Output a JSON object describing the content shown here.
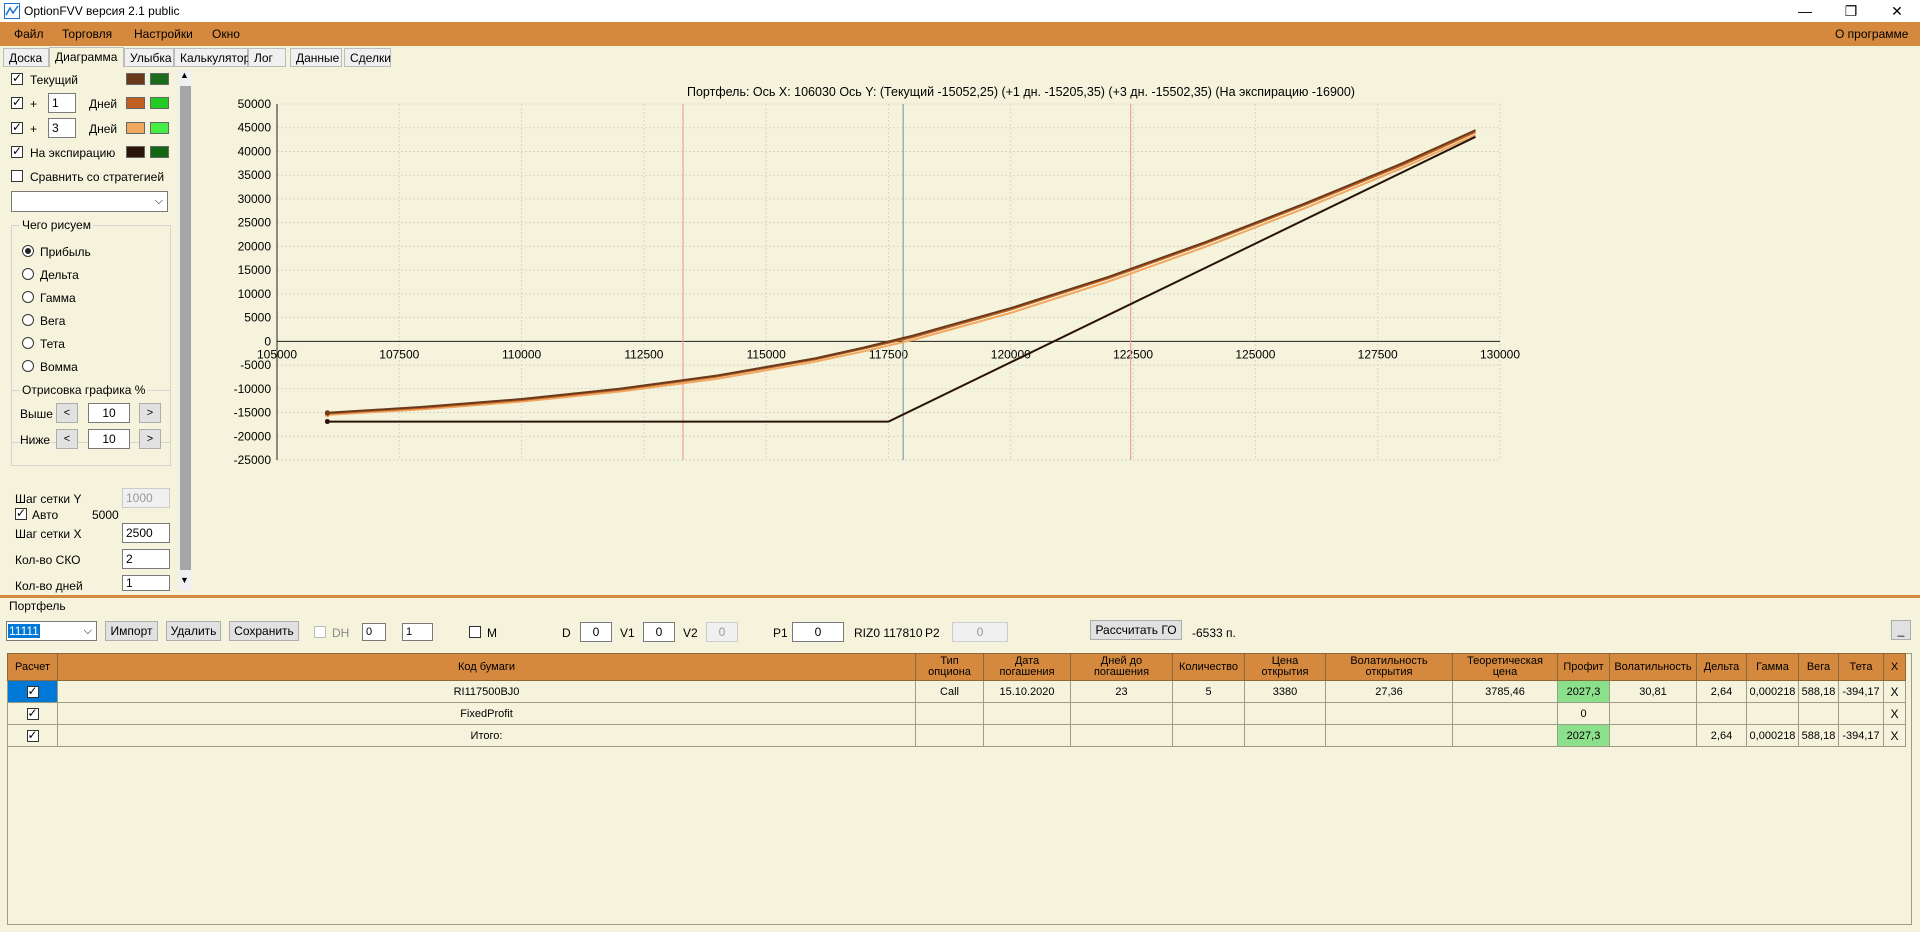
{
  "window": {
    "title": "OptionFVV версия 2.1 public",
    "controls": [
      "—",
      "❐",
      "✕"
    ]
  },
  "menu": {
    "items": [
      "Файл",
      "Торговля",
      "Настройки",
      "Окно"
    ],
    "about": "О программе"
  },
  "tabs": [
    "Доска",
    "Диаграмма",
    "Улыбка",
    "Калькулятор",
    "Лог",
    "Данные",
    "Сделки"
  ],
  "left": {
    "curves": [
      {
        "label": "Текущий",
        "checked": true,
        "colors": [
          "#6b3a1c",
          "#1a6b1a"
        ]
      },
      {
        "prefix": "+",
        "days": "1",
        "label": "Дней",
        "checked": true,
        "colors": [
          "#c06020",
          "#22cc22"
        ]
      },
      {
        "prefix": "+",
        "days": "3",
        "label": "Дней",
        "checked": true,
        "colors": [
          "#f0a860",
          "#44ee44"
        ]
      },
      {
        "label": "На экспирацию",
        "checked": true,
        "colors": [
          "#2a1408",
          "#116611"
        ]
      }
    ],
    "compare_label": "Сравнить со стратегией",
    "what_title": "Чего рисуем",
    "radios": [
      "Прибыль",
      "Дельта",
      "Гамма",
      "Вега",
      "Тета",
      "Вомма"
    ],
    "radio_selected": 0,
    "draw_title": "Отрисовка графика %",
    "above_label": "Выше",
    "above_value": "10",
    "below_label": "Ниже",
    "below_value": "10",
    "left_arrow": "<",
    "right_arrow": ">",
    "grid_y_label": "Шаг сетки Y",
    "grid_y_value": "1000",
    "auto_label": "Авто",
    "auto_value": "5000",
    "grid_x_label": "Шаг сетки X",
    "grid_x_value": "2500",
    "sko_label": "Кол-во СКО",
    "sko_value": "2",
    "days_label": "Кол-во дней",
    "days_value": "1"
  },
  "chart_data": {
    "type": "line",
    "title": "Портфель: Ось X: 106030 Ось Y: (Текущий -15052,25) (+1 дн. -15205,35) (+3 дн. -15502,35) (На экспирацию -16900)",
    "xlim": [
      105000,
      130000
    ],
    "ylim": [
      -25000,
      50000
    ],
    "x_ticks": [
      105000,
      107500,
      110000,
      112500,
      115000,
      117500,
      120000,
      122500,
      125000,
      127500,
      130000
    ],
    "y_ticks": [
      50000,
      45000,
      40000,
      35000,
      30000,
      25000,
      20000,
      15000,
      10000,
      5000,
      0,
      -5000,
      -10000,
      -15000,
      -20000,
      -25000
    ],
    "grid": true,
    "vertical_lines": [
      {
        "x": 113300,
        "color": "#f0a0a0"
      },
      {
        "x": 117800,
        "color": "#8a9bb0"
      },
      {
        "x": 122450,
        "color": "#f0a0a0"
      }
    ],
    "series": [
      {
        "color": "#f0a860",
        "points": [
          [
            106030,
            -15502
          ],
          [
            108000,
            -14300
          ],
          [
            110000,
            -12700
          ],
          [
            112000,
            -10600
          ],
          [
            114000,
            -7900
          ],
          [
            116000,
            -4300
          ],
          [
            117000,
            -2100
          ],
          [
            118000,
            300
          ],
          [
            120000,
            6000
          ],
          [
            122000,
            12600
          ],
          [
            124000,
            20000
          ],
          [
            126000,
            28000
          ],
          [
            128000,
            36500
          ],
          [
            129500,
            43500
          ]
        ]
      },
      {
        "color": "#c06020",
        "points": [
          [
            106030,
            -15205
          ],
          [
            108000,
            -14000
          ],
          [
            110000,
            -12350
          ],
          [
            112000,
            -10200
          ],
          [
            114000,
            -7400
          ],
          [
            116000,
            -3800
          ],
          [
            117000,
            -1500
          ],
          [
            118000,
            900
          ],
          [
            120000,
            6700
          ],
          [
            122000,
            13300
          ],
          [
            124000,
            20700
          ],
          [
            126000,
            28700
          ],
          [
            128000,
            37100
          ],
          [
            129500,
            44100
          ]
        ]
      },
      {
        "color": "#6b3a1c",
        "points": [
          [
            106030,
            -15052
          ],
          [
            108000,
            -13800
          ],
          [
            110000,
            -12150
          ],
          [
            112000,
            -10000
          ],
          [
            114000,
            -7200
          ],
          [
            116000,
            -3600
          ],
          [
            117000,
            -1300
          ],
          [
            118000,
            1200
          ],
          [
            120000,
            7000
          ],
          [
            122000,
            13600
          ],
          [
            124000,
            21000
          ],
          [
            126000,
            29000
          ],
          [
            128000,
            37500
          ],
          [
            129500,
            44500
          ]
        ]
      },
      {
        "color": "#2a1408",
        "points": [
          [
            106030,
            -16900
          ],
          [
            117500,
            -16900
          ],
          [
            129500,
            43100
          ]
        ]
      }
    ]
  },
  "portfolio": {
    "group_label": "Портфель",
    "selected": "11111",
    "import": "Импорт",
    "delete": "Удалить",
    "save": "Сохранить",
    "dh_label": "DH",
    "dh_a": "0",
    "dh_b": "1",
    "m_label": "M",
    "d_label": "D",
    "d_value": "0",
    "v1_label": "V1",
    "v1_value": "0",
    "v2_label": "V2",
    "v2_value": "0",
    "p1_label": "P1",
    "p1_value": "0",
    "riz_text": "RIZ0 117810",
    "p2_label": "P2",
    "p2_value": "0",
    "calc_button": "Рассчитать ГО",
    "go_value": "-6533 п.",
    "minimize": "_"
  },
  "table": {
    "columns": [
      "Расчет",
      "Код бумаги",
      "Тип опциона",
      "Дата погашения",
      "Дней до погашения",
      "Количество",
      "Цена открытия",
      "Волатильность открытия",
      "Теоретическая цена",
      "Профит",
      "Волатильность",
      "Дельта",
      "Гамма",
      "Вега",
      "Тета",
      "X"
    ],
    "rows": [
      {
        "code": "RI117500BJ0",
        "type": "Call",
        "date": "15.10.2020",
        "days": "23",
        "qty": "5",
        "open": "3380",
        "vol_open": "27,36",
        "theo": "3785,46",
        "profit": "2027,3",
        "vol": "30,81",
        "delta": "2,64",
        "gamma": "0,000218",
        "vega": "588,18",
        "theta": "-394,17",
        "x": "X"
      },
      {
        "code": "FixedProfit",
        "type": "",
        "date": "",
        "days": "",
        "qty": "",
        "open": "",
        "vol_open": "",
        "theo": "",
        "profit": "0",
        "vol": "",
        "delta": "",
        "gamma": "",
        "vega": "",
        "theta": "",
        "x": "X"
      },
      {
        "code": "Итого:",
        "type": "",
        "date": "",
        "days": "",
        "qty": "",
        "open": "",
        "vol_open": "",
        "theo": "",
        "profit": "2027,3",
        "vol": "",
        "delta": "2,64",
        "gamma": "0,000218",
        "vega": "588,18",
        "theta": "-394,17",
        "x": "X"
      }
    ]
  }
}
